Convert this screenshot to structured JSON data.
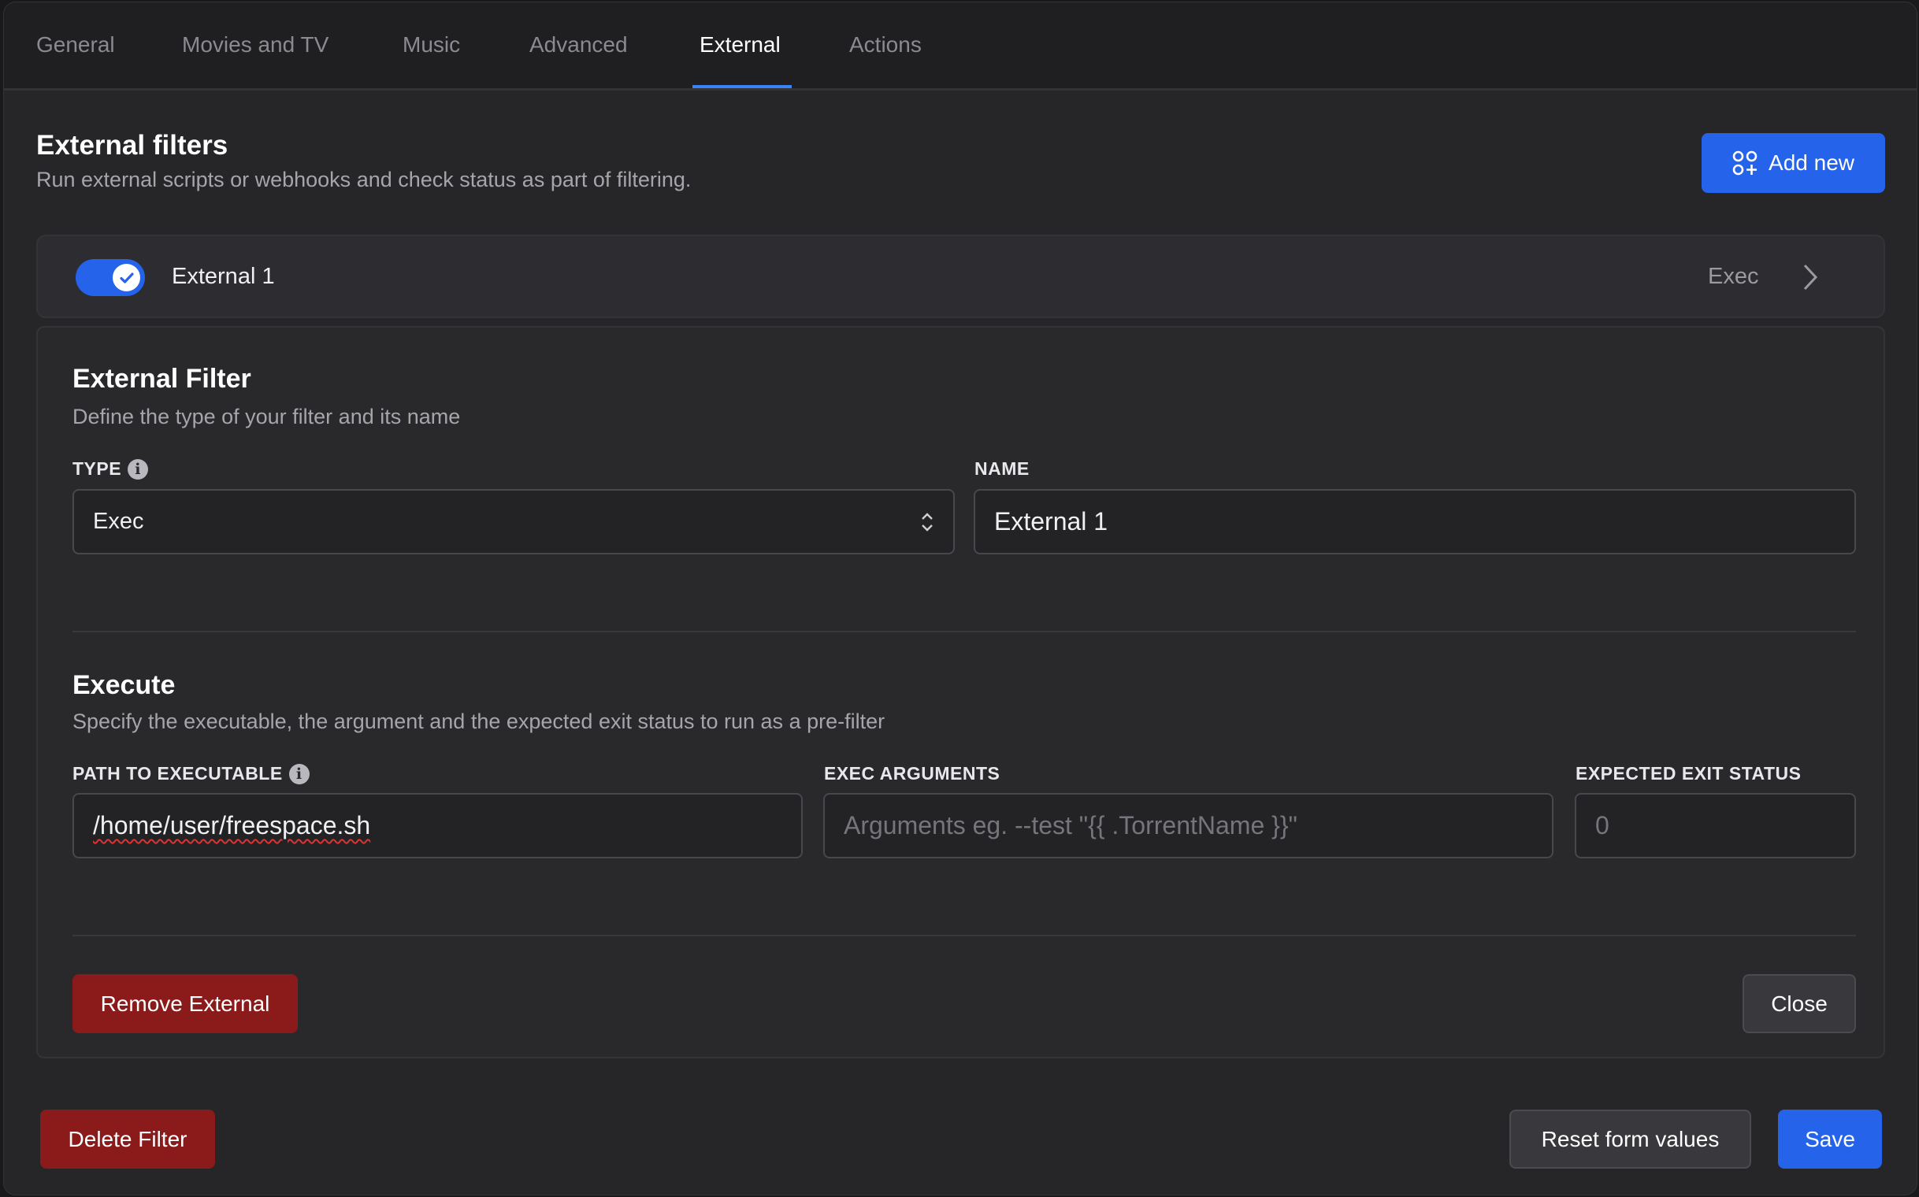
{
  "tabs": [
    {
      "label": "General"
    },
    {
      "label": "Movies and TV"
    },
    {
      "label": "Music"
    },
    {
      "label": "Advanced"
    },
    {
      "label": "External",
      "active": true
    },
    {
      "label": "Actions"
    }
  ],
  "header": {
    "title": "External filters",
    "subtitle": "Run external scripts or webhooks and check status as part of filtering.",
    "add_new_label": "Add new",
    "add_new_icon": "grid-plus-icon"
  },
  "external_item": {
    "enabled": true,
    "name": "External 1",
    "type": "Exec"
  },
  "panel": {
    "section1": {
      "title": "External Filter",
      "description": "Define the type of your filter and its name",
      "type_label": "TYPE",
      "type_value": "Exec",
      "name_label": "NAME",
      "name_value": "External 1"
    },
    "section2": {
      "title": "Execute",
      "description": "Specify the executable, the argument and the expected exit status to run as a pre-filter",
      "path_label": "PATH TO EXECUTABLE",
      "path_value": "/home/user/freespace.sh",
      "args_label": "EXEC ARGUMENTS",
      "args_placeholder": "Arguments eg. --test \"{{ .TorrentName }}\"",
      "exit_label": "EXPECTED EXIT STATUS",
      "exit_placeholder": "0"
    },
    "remove_label": "Remove External",
    "close_label": "Close"
  },
  "footer": {
    "delete_label": "Delete Filter",
    "reset_label": "Reset form values",
    "save_label": "Save"
  },
  "colors": {
    "accent": "#2563eb",
    "danger": "#8b1a1a",
    "background": "#262629"
  }
}
